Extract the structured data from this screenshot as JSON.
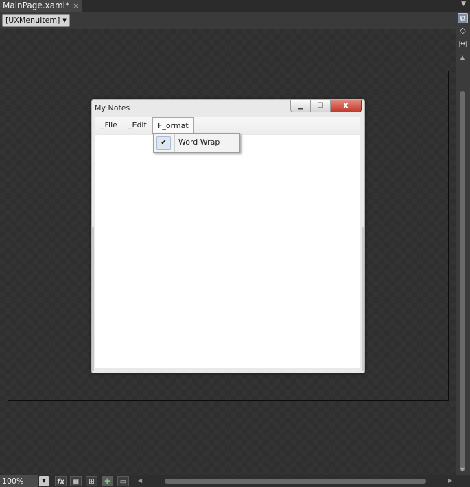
{
  "tab": {
    "title": "MainPage.xaml*",
    "close": "×"
  },
  "breadcrumb": {
    "label": "[UXMenuItem]"
  },
  "window": {
    "title": "My Notes",
    "controls": {
      "close": "X"
    }
  },
  "menubar": {
    "items": [
      {
        "label": "_File"
      },
      {
        "label": "_Edit"
      },
      {
        "label": "F_ormat"
      }
    ]
  },
  "dropdown": {
    "items": [
      {
        "label": "Word Wrap",
        "checked": true
      }
    ]
  },
  "bottombar": {
    "zoom": "100%"
  },
  "icons": {
    "close": "close-icon",
    "chevron_down": "chevron-down-icon",
    "minimize": "minimize-icon",
    "maximize": "maximize-icon",
    "check": "check-icon",
    "code_view": "code-view-icon",
    "fx": "fx-icon",
    "grid": "grid-icon",
    "snap": "snap-icon",
    "annotation": "annotation-icon"
  }
}
